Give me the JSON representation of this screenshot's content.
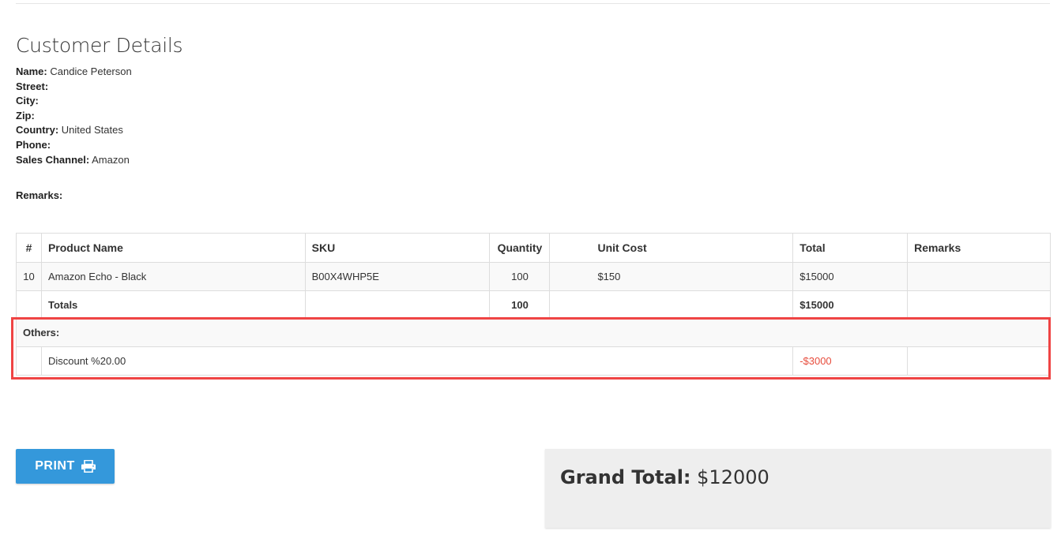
{
  "customer": {
    "title": "Customer Details",
    "fields": [
      {
        "label": "Name:",
        "value": "Candice Peterson"
      },
      {
        "label": "Street:",
        "value": ""
      },
      {
        "label": "City:",
        "value": ""
      },
      {
        "label": "Zip:",
        "value": ""
      },
      {
        "label": "Country:",
        "value": "United States"
      },
      {
        "label": "Phone:",
        "value": ""
      },
      {
        "label": "Sales Channel:",
        "value": "Amazon"
      }
    ],
    "remarks_label": "Remarks:"
  },
  "table": {
    "headers": {
      "num": "#",
      "product": "Product Name",
      "sku": "SKU",
      "quantity": "Quantity",
      "unit_cost": "Unit Cost",
      "total": "Total",
      "remarks": "Remarks"
    },
    "item": {
      "num": "10",
      "product": "Amazon Echo - Black",
      "sku": "B00X4WHP5E",
      "quantity": "100",
      "unit_cost": "$150",
      "total": "$15000",
      "remarks": ""
    },
    "totals": {
      "label": "Totals",
      "quantity": "100",
      "total": "$15000"
    },
    "others": {
      "label": "Others:",
      "discount_label": "Discount %20.00",
      "discount_amount": "-$3000"
    }
  },
  "actions": {
    "print_label": "PRINT",
    "print_icon": "printer-icon"
  },
  "summary": {
    "grand_total_label": "Grand Total:",
    "grand_total_value": "$12000"
  },
  "colors": {
    "primary": "#3498db",
    "negative": "#e74c3c",
    "highlight": "#ef4444"
  }
}
